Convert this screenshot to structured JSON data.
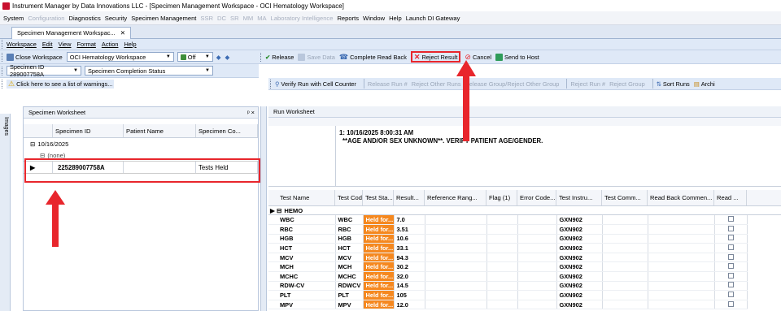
{
  "window": {
    "title": "Instrument Manager by Data Innovations LLC - [Specimen Management Workspace - OCI Hematology Workspace]"
  },
  "menubar": {
    "items": [
      {
        "label": "System",
        "enabled": true
      },
      {
        "label": "Configuration",
        "enabled": false
      },
      {
        "label": "Diagnostics",
        "enabled": true
      },
      {
        "label": "Security",
        "enabled": true
      },
      {
        "label": "Specimen Management",
        "enabled": true
      },
      {
        "label": "SSR",
        "enabled": false
      },
      {
        "label": "DC",
        "enabled": false
      },
      {
        "label": "SR",
        "enabled": false
      },
      {
        "label": "MM",
        "enabled": false
      },
      {
        "label": "MA",
        "enabled": false
      },
      {
        "label": "Laboratory Intelligence",
        "enabled": false
      },
      {
        "label": "Reports",
        "enabled": true
      },
      {
        "label": "Window",
        "enabled": true
      },
      {
        "label": "Help",
        "enabled": true
      },
      {
        "label": "Launch DI Gateway",
        "enabled": true
      }
    ]
  },
  "doc_tab": {
    "label": "Specimen Management Workspac..."
  },
  "workspace_menu": [
    "Workspace",
    "Edit",
    "View",
    "Format",
    "Action",
    "Help"
  ],
  "toolbar1": {
    "close_workspace": "Close Workspace",
    "workspace_combo": "OCI Hematology Workspace",
    "off_label": "Off"
  },
  "toolbar2": {
    "specimen_id": "Specimen ID 289007758A",
    "status_combo": "Specimen Completion Status"
  },
  "warnings": {
    "label": "Click here to see a list of warnings..."
  },
  "action_toolbar": {
    "release": "Release",
    "save_data": "Save Data",
    "complete_read_back": "Complete Read Back",
    "reject_result": "Reject Result",
    "cancel": "Cancel",
    "send_to_host": "Send to Host"
  },
  "run_toolbar": {
    "verify_run": "Verify Run with Cell Counter",
    "release_run": "Release Run #",
    "reject_other_runs": "Reject Other Runs",
    "release_group": "Release Group/Reject Other Group",
    "reject_run": "Reject Run #",
    "reject_group": "Reject Group",
    "sort_runs": "Sort Runs",
    "archive": "Archi"
  },
  "left_strip": {
    "label": "Images"
  },
  "specimen_worksheet": {
    "title": "Specimen Worksheet",
    "pin": "ᵖ ×",
    "columns": [
      "Specimen ID",
      "Patient Name",
      "Specimen Co..."
    ],
    "date_group": "10/16/2025",
    "none_group": "(none)",
    "row": {
      "specimen_id": "225289007758A",
      "patient_name": "",
      "status": "Tests Held"
    }
  },
  "run_worksheet": {
    "title": "Run Worksheet",
    "run_header": "1: 10/16/2025 8:00:31 AM",
    "message": "**AGE AND/OR SEX UNKNOWN**. VERIFY PATIENT AGE/GENDER.",
    "columns": [
      "Test Name",
      "Test Cod...",
      "Test Sta...",
      "Result...",
      "Reference Rang...",
      "Flag (1)",
      "Error Code...",
      "Test Instru...",
      "Test Comm...",
      "Read Back Commen...",
      "Read ..."
    ],
    "group": "HEMO",
    "rows": [
      {
        "name": "WBC",
        "code": "WBC",
        "status": "Held for...",
        "result": "7.0",
        "instrument": "GXN902"
      },
      {
        "name": "RBC",
        "code": "RBC",
        "status": "Held for...",
        "result": "3.51",
        "instrument": "GXN902"
      },
      {
        "name": "HGB",
        "code": "HGB",
        "status": "Held for...",
        "result": "10.6",
        "instrument": "GXN902"
      },
      {
        "name": "HCT",
        "code": "HCT",
        "status": "Held for...",
        "result": "33.1",
        "instrument": "GXN902"
      },
      {
        "name": "MCV",
        "code": "MCV",
        "status": "Held for...",
        "result": "94.3",
        "instrument": "GXN902"
      },
      {
        "name": "MCH",
        "code": "MCH",
        "status": "Held for...",
        "result": "30.2",
        "instrument": "GXN902"
      },
      {
        "name": "MCHC",
        "code": "MCHC",
        "status": "Held for...",
        "result": "32.0",
        "instrument": "GXN902"
      },
      {
        "name": "RDW-CV",
        "code": "RDWCV",
        "status": "Held for...",
        "result": "14.5",
        "instrument": "GXN902"
      },
      {
        "name": "PLT",
        "code": "PLT",
        "status": "Held for...",
        "result": "105",
        "instrument": "GXN902"
      },
      {
        "name": "MPV",
        "code": "MPV",
        "status": "Held for...",
        "result": "12.0",
        "instrument": "GXN902"
      }
    ]
  },
  "colors": {
    "accent": "#e8262c",
    "held": "#f5881f",
    "toolbar": "#dfe9f7"
  }
}
